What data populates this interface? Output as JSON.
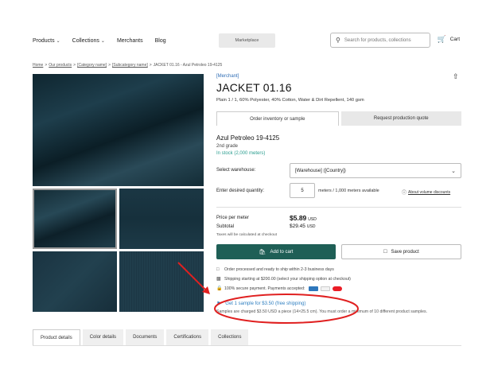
{
  "nav": {
    "products": "Products",
    "collections": "Collections",
    "merchants": "Merchants",
    "blog": "Blog",
    "marketplace": "Marketplace",
    "search_placeholder": "Search for products, collections",
    "cart": "Cart"
  },
  "breadcrumb": {
    "home": "Home",
    "products": "Our products",
    "category": "[Category name]",
    "subcategory": "[Subcategory name]",
    "current": "JACKET 01.16 - Azul Petroleo 19-4125"
  },
  "product": {
    "merchant": "[Merchant]",
    "title": "JACKET 01.16",
    "description": "Plain 1 / 1, 60% Polyester, 40% Cotton, Water & Dirt Repellent, 140 gsm",
    "tab_order": "Order inventory or sample",
    "tab_request": "Request production quote",
    "color_name": "Azul Petroleo 19-4125",
    "grade": "2nd grade",
    "stock": "In stock (2,000 meters)",
    "warehouse_label": "Select warehouse:",
    "warehouse_value": "[Warehouse] ([Country])",
    "qty_label": "Enter desired quantity:",
    "qty_value": "5",
    "qty_note": "meters / 1,000 meters available",
    "volume_discounts": "About volume discounts",
    "price_label": "Price per meter",
    "price_value": "$5.89",
    "price_currency": "USD",
    "subtotal_label": "Subtotal",
    "subtotal_value": "$29.45",
    "subtotal_currency": "USD",
    "taxes_note": "Taxes will be calculated at checkout",
    "add_to_cart": "Add to cart",
    "save_product": "Save product",
    "info_processed": "Order processed and ready to ship within 2-3 business days",
    "info_shipping": "Shipping starting at $200.00 (select your shipping option at checkout)",
    "info_payment": "100% secure payment. Payments accepted:",
    "sample_link": "Get 1 sample for $3.50 (free shipping)",
    "sample_note": "Samples are charged $3.50 USD a piece (14×25.5 cm). You must order a minimum of 10 different product samples."
  },
  "tabs_bottom": [
    "Product details",
    "Color details",
    "Documents",
    "Certifications",
    "Collections"
  ],
  "colors": {
    "accent_green": "#1f5f56",
    "stock_green": "#2a9d8f",
    "link_blue": "#2f7fc0",
    "annotation_red": "#e02020"
  }
}
